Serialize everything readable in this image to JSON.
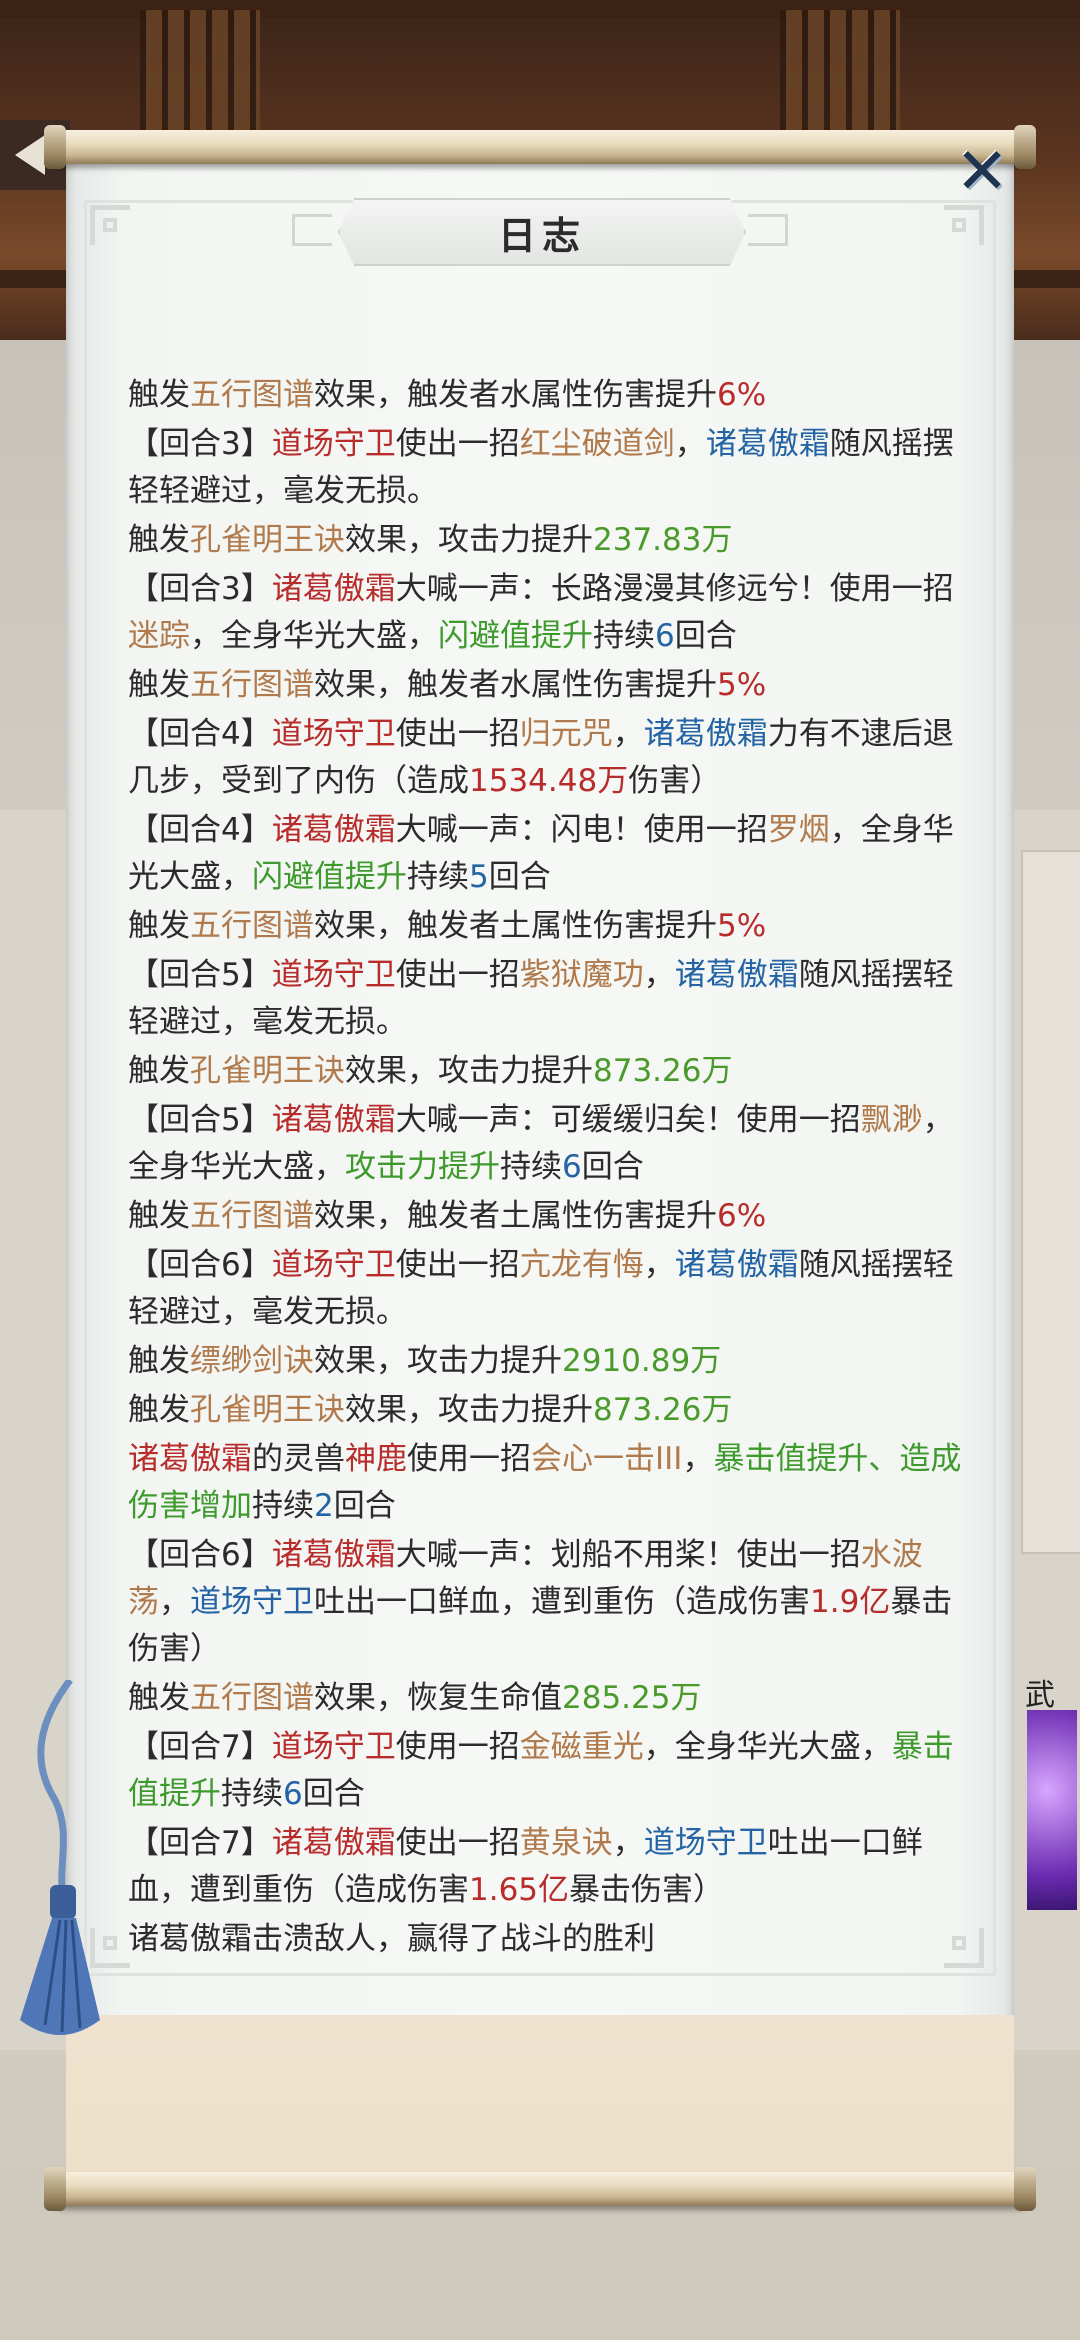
{
  "title": "日志",
  "close_icon": "x-close-icon",
  "back_icon": "back-arrow-icon",
  "colors": {
    "skill": "#b07a4c",
    "red_name": "#b82c2c",
    "blue_name": "#2464a4",
    "buff": "#3e9a2c",
    "number": "#4a9a2c",
    "text": "#2b2b2b"
  },
  "log": [
    [
      [
        "t",
        "触发"
      ],
      [
        "s",
        "五行图谱"
      ],
      [
        "t",
        "效果，触发者水属性伤害提升"
      ],
      [
        "r",
        "6%"
      ]
    ],
    [
      [
        "t",
        "【回合3】"
      ],
      [
        "r",
        "道场守卫"
      ],
      [
        "t",
        "使出一招"
      ],
      [
        "s",
        "红尘破道剑"
      ],
      [
        "t",
        "，"
      ],
      [
        "b",
        "诸葛傲霜"
      ],
      [
        "t",
        "随风摇摆轻轻避过，毫发无损。"
      ]
    ],
    [
      [
        "t",
        "触发"
      ],
      [
        "s",
        "孔雀明王诀"
      ],
      [
        "t",
        "效果，攻击力提升"
      ],
      [
        "n",
        "237.83万"
      ]
    ],
    [
      [
        "t",
        "【回合3】"
      ],
      [
        "r",
        "诸葛傲霜"
      ],
      [
        "t",
        "大喊一声：长路漫漫其修远兮！使用一招"
      ],
      [
        "s",
        "迷踪"
      ],
      [
        "t",
        "，全身华光大盛，"
      ],
      [
        "g",
        "闪避值提升"
      ],
      [
        "t",
        "持续"
      ],
      [
        "b",
        "6"
      ],
      [
        "t",
        "回合"
      ]
    ],
    [
      [
        "t",
        "触发"
      ],
      [
        "s",
        "五行图谱"
      ],
      [
        "t",
        "效果，触发者水属性伤害提升"
      ],
      [
        "r",
        "5%"
      ]
    ],
    [
      [
        "t",
        "【回合4】"
      ],
      [
        "r",
        "道场守卫"
      ],
      [
        "t",
        "使出一招"
      ],
      [
        "s",
        "归元咒"
      ],
      [
        "t",
        "，"
      ],
      [
        "b",
        "诸葛傲霜"
      ],
      [
        "t",
        "力有不逮后退几步，受到了内伤（造成"
      ],
      [
        "r",
        "1534.48万"
      ],
      [
        "t",
        "伤害）"
      ]
    ],
    [
      [
        "t",
        "【回合4】"
      ],
      [
        "r",
        "诸葛傲霜"
      ],
      [
        "t",
        "大喊一声：闪电！使用一招"
      ],
      [
        "s",
        "罗烟"
      ],
      [
        "t",
        "，全身华光大盛，"
      ],
      [
        "g",
        "闪避值提升"
      ],
      [
        "t",
        "持续"
      ],
      [
        "b",
        "5"
      ],
      [
        "t",
        "回合"
      ]
    ],
    [
      [
        "t",
        "触发"
      ],
      [
        "s",
        "五行图谱"
      ],
      [
        "t",
        "效果，触发者土属性伤害提升"
      ],
      [
        "r",
        "5%"
      ]
    ],
    [
      [
        "t",
        "【回合5】"
      ],
      [
        "r",
        "道场守卫"
      ],
      [
        "t",
        "使出一招"
      ],
      [
        "s",
        "紫狱魔功"
      ],
      [
        "t",
        "，"
      ],
      [
        "b",
        "诸葛傲霜"
      ],
      [
        "t",
        "随风摇摆轻轻避过，毫发无损。"
      ]
    ],
    [
      [
        "t",
        "触发"
      ],
      [
        "s",
        "孔雀明王诀"
      ],
      [
        "t",
        "效果，攻击力提升"
      ],
      [
        "n",
        "873.26万"
      ]
    ],
    [
      [
        "t",
        "【回合5】"
      ],
      [
        "r",
        "诸葛傲霜"
      ],
      [
        "t",
        "大喊一声：可缓缓归矣！使用一招"
      ],
      [
        "s",
        "飘渺"
      ],
      [
        "t",
        "，全身华光大盛，"
      ],
      [
        "g",
        "攻击力提升"
      ],
      [
        "t",
        "持续"
      ],
      [
        "b",
        "6"
      ],
      [
        "t",
        "回合"
      ]
    ],
    [
      [
        "t",
        "触发"
      ],
      [
        "s",
        "五行图谱"
      ],
      [
        "t",
        "效果，触发者土属性伤害提升"
      ],
      [
        "r",
        "6%"
      ]
    ],
    [
      [
        "t",
        "【回合6】"
      ],
      [
        "r",
        "道场守卫"
      ],
      [
        "t",
        "使出一招"
      ],
      [
        "s",
        "亢龙有悔"
      ],
      [
        "t",
        "，"
      ],
      [
        "b",
        "诸葛傲霜"
      ],
      [
        "t",
        "随风摇摆轻轻避过，毫发无损。"
      ]
    ],
    [
      [
        "t",
        "触发"
      ],
      [
        "s",
        "缥缈剑诀"
      ],
      [
        "t",
        "效果，攻击力提升"
      ],
      [
        "n",
        "2910.89万"
      ]
    ],
    [
      [
        "t",
        "触发"
      ],
      [
        "s",
        "孔雀明王诀"
      ],
      [
        "t",
        "效果，攻击力提升"
      ],
      [
        "n",
        "873.26万"
      ]
    ],
    [
      [
        "r",
        "诸葛傲霜"
      ],
      [
        "t",
        "的灵兽"
      ],
      [
        "r",
        "神鹿"
      ],
      [
        "t",
        "使用一招"
      ],
      [
        "s",
        "会心一击III"
      ],
      [
        "t",
        "，"
      ],
      [
        "g",
        "暴击值提升、造成伤害增加"
      ],
      [
        "t",
        "持续"
      ],
      [
        "b",
        "2"
      ],
      [
        "t",
        "回合"
      ]
    ],
    [
      [
        "t",
        "【回合6】"
      ],
      [
        "r",
        "诸葛傲霜"
      ],
      [
        "t",
        "大喊一声：划船不用桨！使出一招"
      ],
      [
        "s",
        "水波荡"
      ],
      [
        "t",
        "，"
      ],
      [
        "b",
        "道场守卫"
      ],
      [
        "t",
        "吐出一口鲜血，遭到重伤（造成伤害"
      ],
      [
        "r",
        "1.9亿"
      ],
      [
        "t",
        "暴击伤害）"
      ]
    ],
    [
      [
        "t",
        "触发"
      ],
      [
        "s",
        "五行图谱"
      ],
      [
        "t",
        "效果，恢复生命值"
      ],
      [
        "n",
        "285.25万"
      ]
    ],
    [
      [
        "t",
        "【回合7】"
      ],
      [
        "r",
        "道场守卫"
      ],
      [
        "t",
        "使用一招"
      ],
      [
        "s",
        "金磁重光"
      ],
      [
        "t",
        "，全身华光大盛，"
      ],
      [
        "g",
        "暴击值提升"
      ],
      [
        "t",
        "持续"
      ],
      [
        "b",
        "6"
      ],
      [
        "t",
        "回合"
      ]
    ],
    [
      [
        "t",
        "【回合7】"
      ],
      [
        "r",
        "诸葛傲霜"
      ],
      [
        "t",
        "使出一招"
      ],
      [
        "s",
        "黄泉诀"
      ],
      [
        "t",
        "，"
      ],
      [
        "b",
        "道场守卫"
      ],
      [
        "t",
        "吐出一口鲜血，遭到重伤（造成伤害"
      ],
      [
        "r",
        "1.65亿"
      ],
      [
        "t",
        "暴击伤害）"
      ]
    ],
    [
      [
        "t",
        "诸葛傲霜击溃敌人，赢得了战斗的胜利"
      ]
    ]
  ]
}
